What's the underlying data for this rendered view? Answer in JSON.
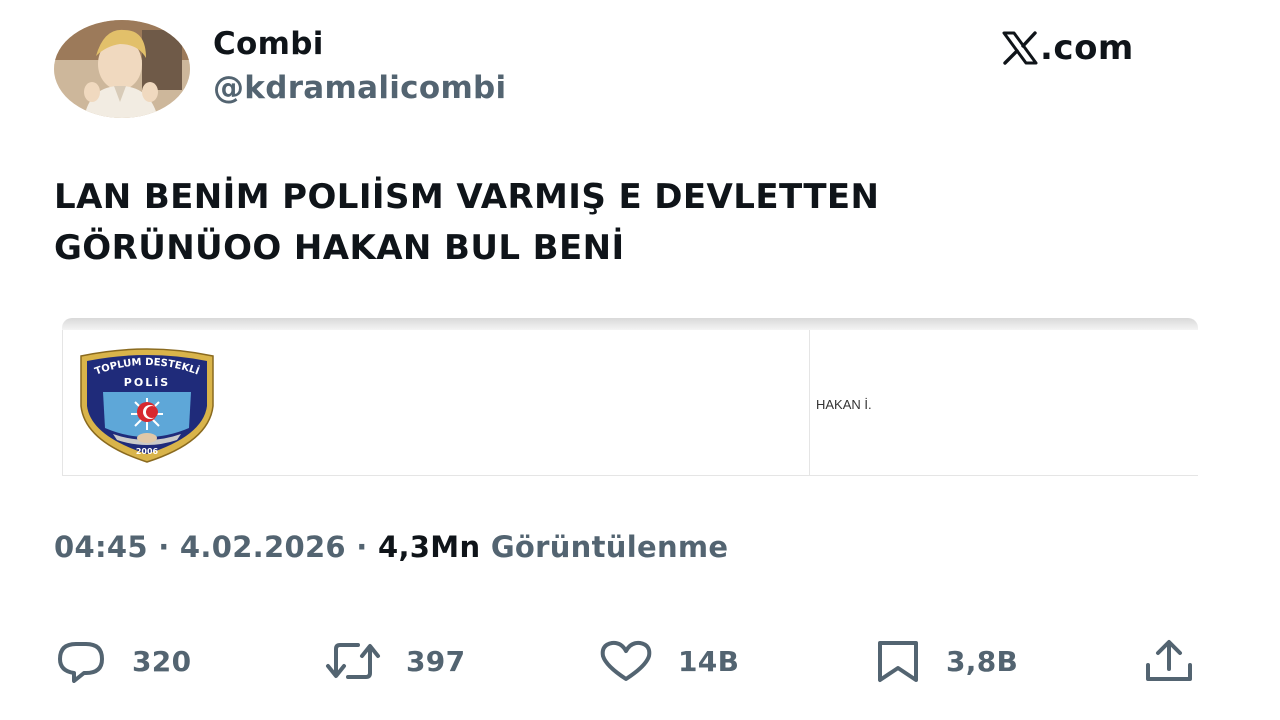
{
  "tweet": {
    "author": {
      "display_name": "Combi",
      "handle": "@kdramalicombi"
    },
    "brand": "X.com",
    "brand_suffix": ".com",
    "text_lines": [
      "LAN BENİM POLIİSM VARMIŞ E DEVLETTEN",
      "GÖRÜNÜOO HAKAN BUL BENİ"
    ],
    "media": {
      "badge_top_text": "TOPLUM DESTEKLİ",
      "badge_mid_text": "POLİS",
      "badge_year": "2006",
      "name_text": "HAKAN İ."
    },
    "meta": {
      "time": "04:45",
      "separator": " · ",
      "date": "4.02.2026",
      "views_count": "4,3Mn",
      "views_label": "Görüntülenme"
    },
    "actions": {
      "replies": "320",
      "reposts": "397",
      "likes": "14B",
      "bookmarks": "3,8B"
    },
    "colors": {
      "text_primary": "#0f1419",
      "text_secondary": "#536471",
      "badge_navy": "#1f2b7a",
      "badge_gold": "#d9b44a"
    },
    "icons": [
      "reply-icon",
      "repost-icon",
      "like-icon",
      "bookmark-icon",
      "share-icon",
      "x-logo-icon"
    ]
  }
}
